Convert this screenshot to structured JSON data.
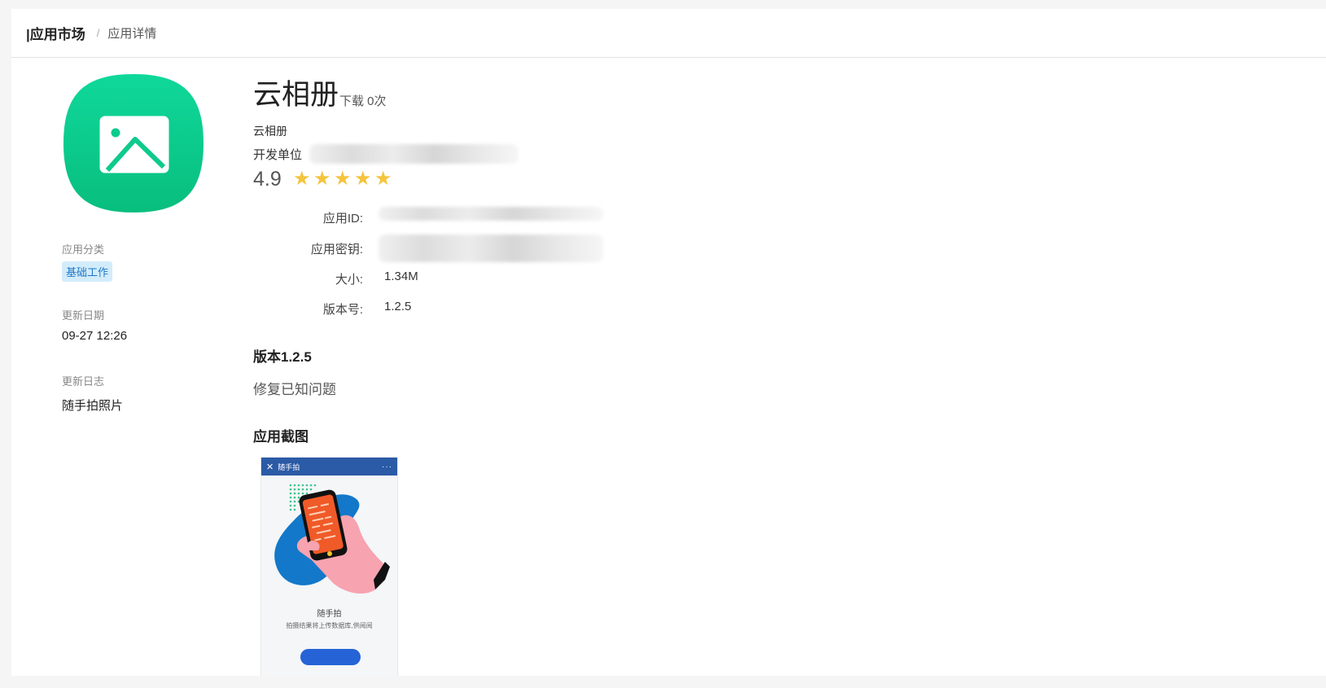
{
  "breadcrumb": {
    "root": "|应用市场",
    "separator": "/",
    "current": "应用详情"
  },
  "app": {
    "name": "云相册",
    "downloads": "下载 0次",
    "subtitle": "云相册",
    "developer_label": "开发单位",
    "rating": "4.9",
    "stars": [
      "★",
      "★",
      "★",
      "★",
      "★"
    ],
    "icon": "image-icon",
    "icon_color": "#0fc98c"
  },
  "sidebar": {
    "category_label": "应用分类",
    "category_tag": "基础工作",
    "date_label": "更新日期",
    "date_value": "09-27 12:26",
    "log_label": "更新日志",
    "log_value": "随手拍照片"
  },
  "details": {
    "app_id_label": "应用ID:",
    "app_secret_label": "应用密钥:",
    "size_label": "大小:",
    "size_value": "1.34M",
    "version_label": "版本号:",
    "version_value": "1.2.5"
  },
  "version_section": {
    "title": "版本1.2.5",
    "notes": "修复已知问题"
  },
  "screenshots": {
    "title": "应用截图",
    "shot": {
      "bar_title": "随手拍",
      "close_glyph": "✕",
      "more_glyph": "···",
      "caption": "随手拍",
      "description": "拍摄结果将上传数据库,供阅阅",
      "bar_color": "#2b5aa6"
    }
  }
}
